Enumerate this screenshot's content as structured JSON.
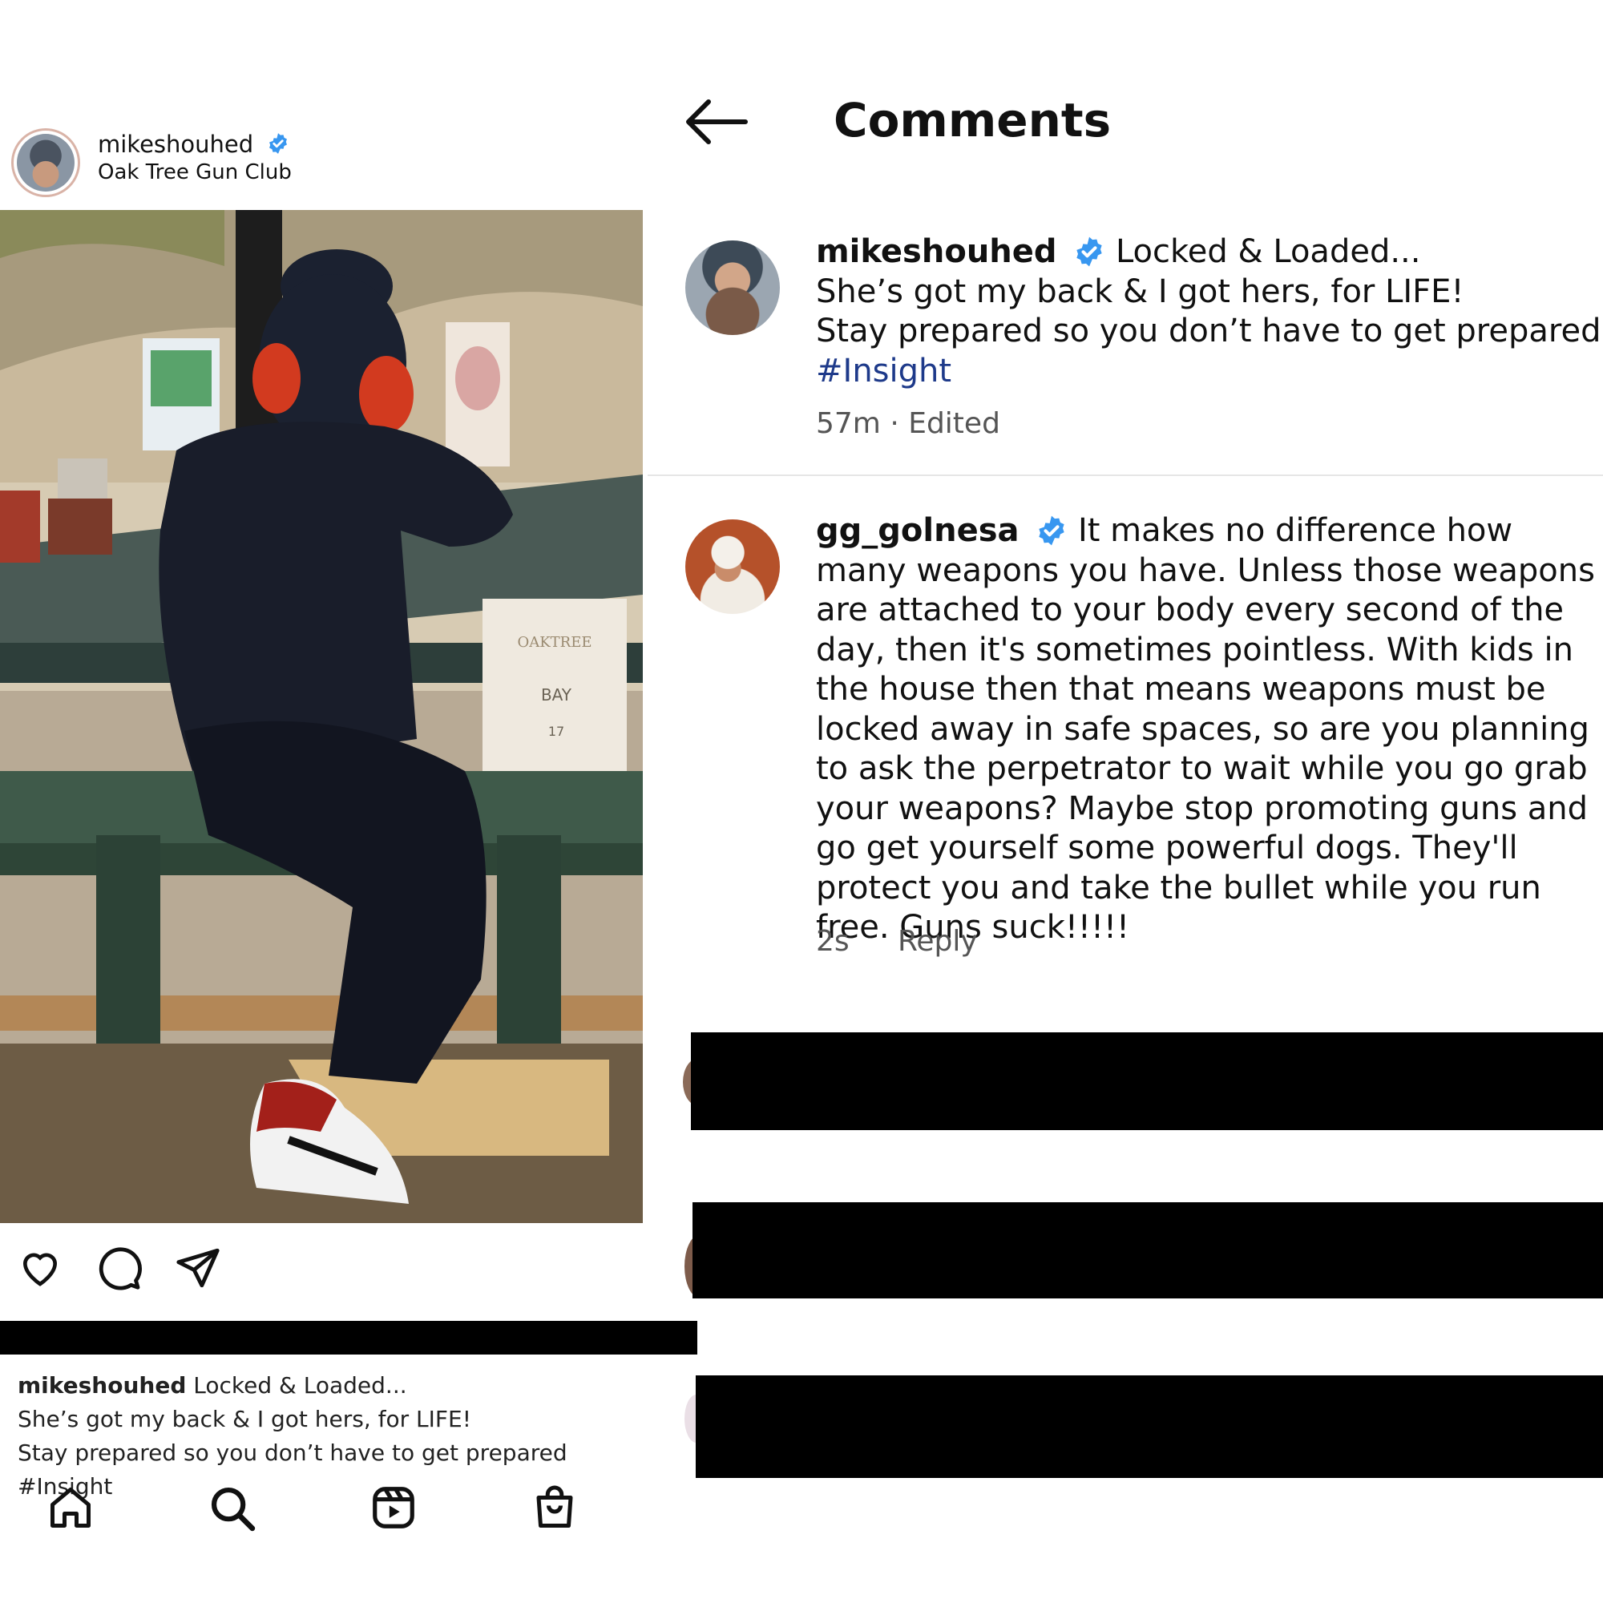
{
  "post": {
    "username": "mikeshouhed",
    "location": "Oak Tree Gun Club",
    "photo_sign_top": "OAKTREE",
    "photo_sign_bay": "BAY",
    "photo_sign_number": "17",
    "caption": {
      "username": "mikeshouhed",
      "line1": "Locked & Loaded...",
      "line2": "She’s got my back & I got hers, for LIFE!",
      "line3": "Stay prepared so you don’t have to get prepared #Insight"
    },
    "icons": [
      "heart-icon",
      "comment-icon",
      "share-icon"
    ],
    "nav_icons": [
      "home-icon",
      "search-icon",
      "reels-icon",
      "shop-icon"
    ]
  },
  "comments_panel": {
    "title": "Comments",
    "comments": [
      {
        "username": "mikeshouhed",
        "line1": "Locked & Loaded...",
        "line2": "She’s got my back & I got hers, for LIFE!",
        "line3": "Stay prepared so you don’t have to get prepared",
        "hashtag": "#Insight",
        "meta": "57m · Edited"
      },
      {
        "username": "gg_golnesa",
        "text": "It makes no difference how many weapons you have. Unless those weapons are attached to your body every second of the day, then it's sometimes pointless. With kids in the house then that means weapons must be locked away in safe spaces, so are you planning to ask the perpetrator to wait while you go grab your weapons? Maybe stop promoting guns and go get yourself some powerful dogs. They'll protect you and take the bullet while you run free. Guns suck!!!!!",
        "time": "2s",
        "reply": "Reply"
      }
    ]
  },
  "colors": {
    "verified": "#3897f0",
    "hashtag": "#1e3a8a",
    "redaction": "#000000"
  }
}
